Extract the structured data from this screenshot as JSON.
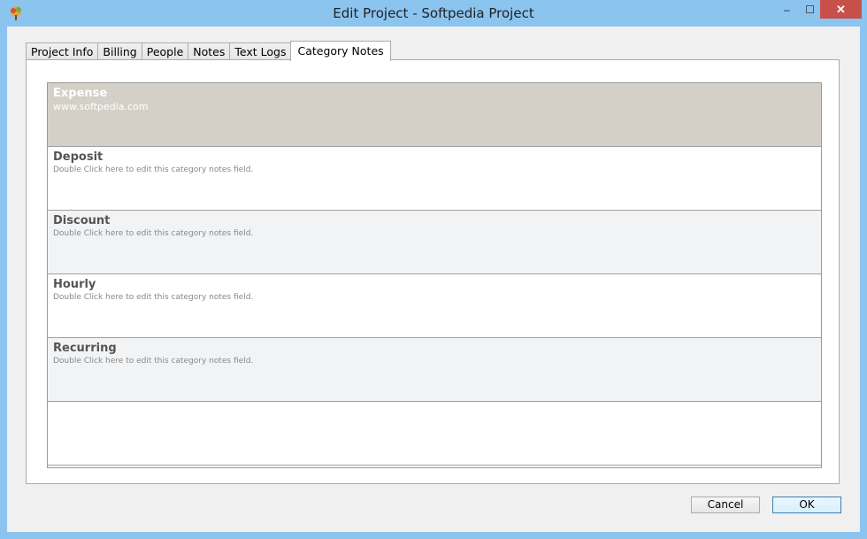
{
  "window": {
    "title": "Edit Project - Softpedia Project",
    "controls": {
      "minimize": "–",
      "maximize": "☐",
      "close": "✕"
    }
  },
  "tabs": [
    {
      "label": "Project Info",
      "active": false
    },
    {
      "label": "Billing",
      "active": false
    },
    {
      "label": "People",
      "active": false
    },
    {
      "label": "Notes",
      "active": false
    },
    {
      "label": "Text Logs",
      "active": false
    },
    {
      "label": "Category Notes",
      "active": true
    }
  ],
  "categories": [
    {
      "title": "Expense",
      "note": "www.softpedia.com",
      "selected": true
    },
    {
      "title": "Deposit",
      "note": "Double Click here to edit this category notes field.",
      "selected": false
    },
    {
      "title": "Discount",
      "note": "Double Click here to edit this category notes field.",
      "selected": false
    },
    {
      "title": "Hourly",
      "note": "Double Click here to edit this category notes field.",
      "selected": false
    },
    {
      "title": "Recurring",
      "note": "Double Click here to edit this category notes field.",
      "selected": false
    }
  ],
  "buttons": {
    "cancel": "Cancel",
    "ok": "OK"
  },
  "colors": {
    "titlebar": "#8cc4f0",
    "selected_row": "#d4d0c8",
    "close": "#c7504a"
  },
  "icons": {
    "app": "tree-app-icon"
  }
}
